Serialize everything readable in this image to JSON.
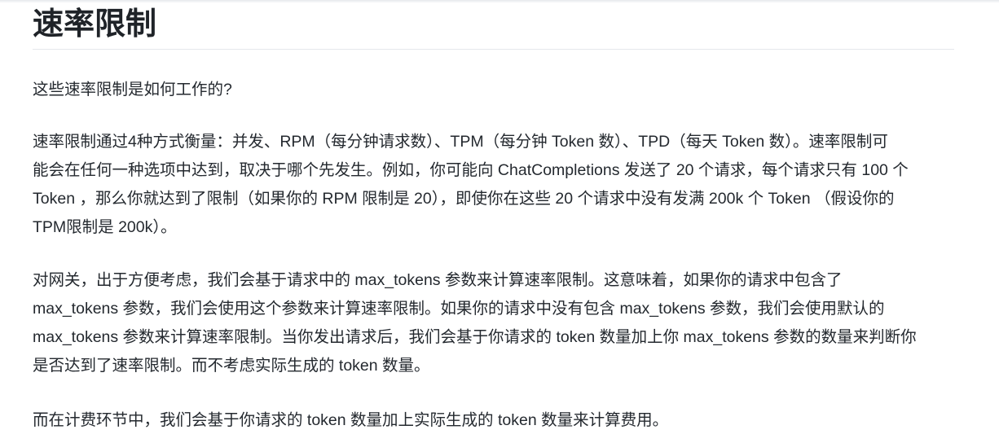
{
  "heading": "速率限制",
  "paragraphs": {
    "question": "这些速率限制是如何工作的?",
    "measure": [
      "速率限制通过4种方式衡量：并发、RPM（每分钟请求数）、TPM（每分钟 Token 数）、TPD（每天 Token 数）。速率限制可",
      "能会在任何一种选项中达到，取决于哪个先发生。例如，你可能向 ChatCompletions 发送了 20 个请求，每个请求只有 100 个",
      "Token ，那么你就达到了限制（如果你的 RPM 限制是 20），即使你在这些 20 个请求中没有发满 200k 个 Token （假设你的",
      "TPM限制是 200k）。"
    ],
    "gateway": [
      "对网关，出于方便考虑，我们会基于请求中的 max_tokens 参数来计算速率限制。这意味着，如果你的请求中包含了",
      "max_tokens 参数，我们会使用这个参数来计算速率限制。如果你的请求中没有包含 max_tokens 参数，我们会使用默认的",
      "max_tokens 参数来计算速率限制。当你发出请求后，我们会基于你请求的 token 数量加上你 max_tokens 参数的数量来判断你",
      "是否达到了速率限制。而不考虑实际生成的 token 数量。"
    ],
    "billing": "而在计费环节中，我们会基于你请求的 token 数量加上实际生成的 token 数量来计算费用。"
  }
}
